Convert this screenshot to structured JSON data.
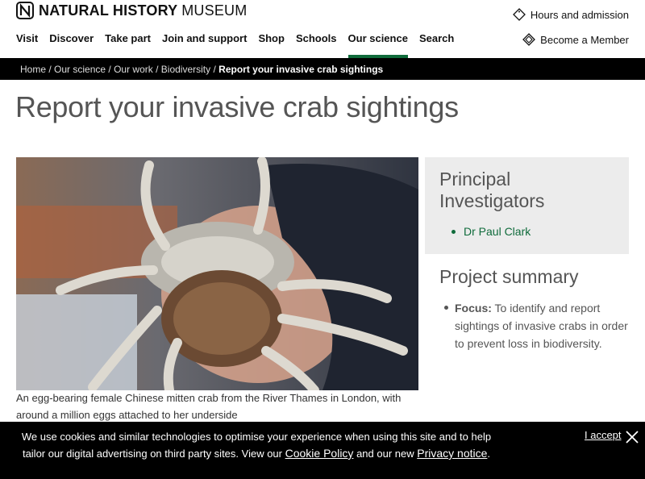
{
  "header": {
    "logo_bold": "NATURAL HISTORY",
    "logo_thin": "MUSEUM",
    "hours_label": "Hours and admission",
    "member_label": "Become a Member"
  },
  "nav": {
    "items": [
      "Visit",
      "Discover",
      "Take part",
      "Join and support",
      "Shop",
      "Schools",
      "Our science",
      "Search"
    ],
    "active": "Our science"
  },
  "breadcrumb": {
    "home": "Home",
    "our_science": "Our science",
    "our_work": "Our work",
    "biodiversity": "Biodiversity",
    "current": "Report your invasive crab sightings"
  },
  "page": {
    "title": "Report your invasive crab sightings",
    "image_caption": "An egg-bearing female Chinese mitten crab from the River Thames in London, with around a million eggs attached to her underside"
  },
  "sidebar": {
    "pi_heading": "Principal Investigators",
    "pi_name": "Dr Paul Clark",
    "summary_heading": "Project summary",
    "focus_label": "Focus:",
    "focus_text": "To identify and report sightings of invasive crabs in order to prevent loss in biodiversity."
  },
  "cookie": {
    "text_before": "We use cookies and similar technologies to optimise your experience when using this site and to help tailor our digital advertising on third party sites. View our",
    "cookie_link": "Cookie Policy",
    "text_mid": "and our new",
    "privacy_link": "Privacy notice",
    "text_end": ".",
    "accept_label": "I accept"
  },
  "colors": {
    "accent_green": "#0f6b3b",
    "breadcrumb_bg": "#000000",
    "sidebar_bg": "#ececec"
  },
  "icons": [
    "nhm-logo-icon",
    "ticket-icon",
    "member-diamond-icon",
    "close-icon"
  ]
}
